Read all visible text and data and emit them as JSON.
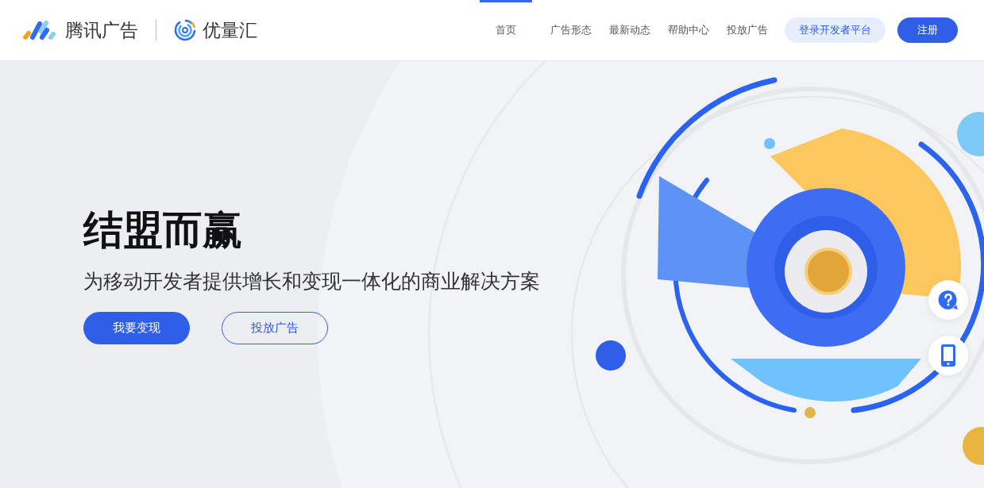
{
  "header": {
    "brand": "腾讯广告",
    "product": "优量汇",
    "nav": [
      {
        "label": "首页",
        "selected": true
      },
      {
        "label": "广告形态",
        "selected": false
      },
      {
        "label": "最新动态",
        "selected": false
      },
      {
        "label": "帮助中心",
        "selected": false
      },
      {
        "label": "投放广告",
        "selected": false
      }
    ],
    "login_button": "登录开发者平台",
    "register_button": "注册"
  },
  "hero": {
    "title": "结盟而赢",
    "subtitle": "为移动开发者提供增长和变现一体化的商业解决方案",
    "buttons": [
      {
        "label": "我要变现",
        "kind": "primary"
      },
      {
        "label": "投放广告",
        "kind": "outline"
      }
    ]
  },
  "side_tools": [
    {
      "kind": "help"
    },
    {
      "kind": "phone"
    }
  ]
}
